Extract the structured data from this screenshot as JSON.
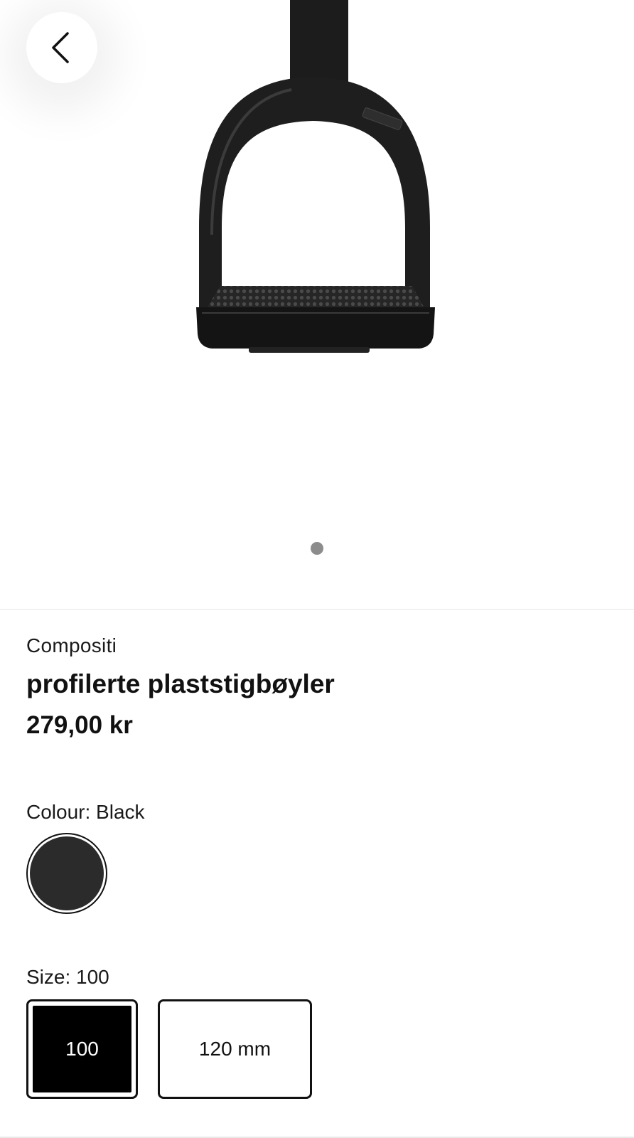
{
  "product": {
    "brand": "Compositi",
    "title": "profilerte plaststigbøyler",
    "price": "279,00 kr",
    "image_count": 1,
    "current_image": 1
  },
  "navigation": {
    "back_icon": "chevron-left-icon"
  },
  "colour": {
    "label": "Colour: Black",
    "options": [
      {
        "name": "Black",
        "hex": "#2b2b2b",
        "selected": true
      }
    ]
  },
  "size": {
    "label": "Size: 100",
    "options": [
      {
        "label": "100",
        "selected": true
      },
      {
        "label": "120 mm",
        "selected": false
      }
    ]
  },
  "colors": {
    "accent": "#000000",
    "pager_dot": "#8c8c8c",
    "divider": "#e6e6e6"
  }
}
